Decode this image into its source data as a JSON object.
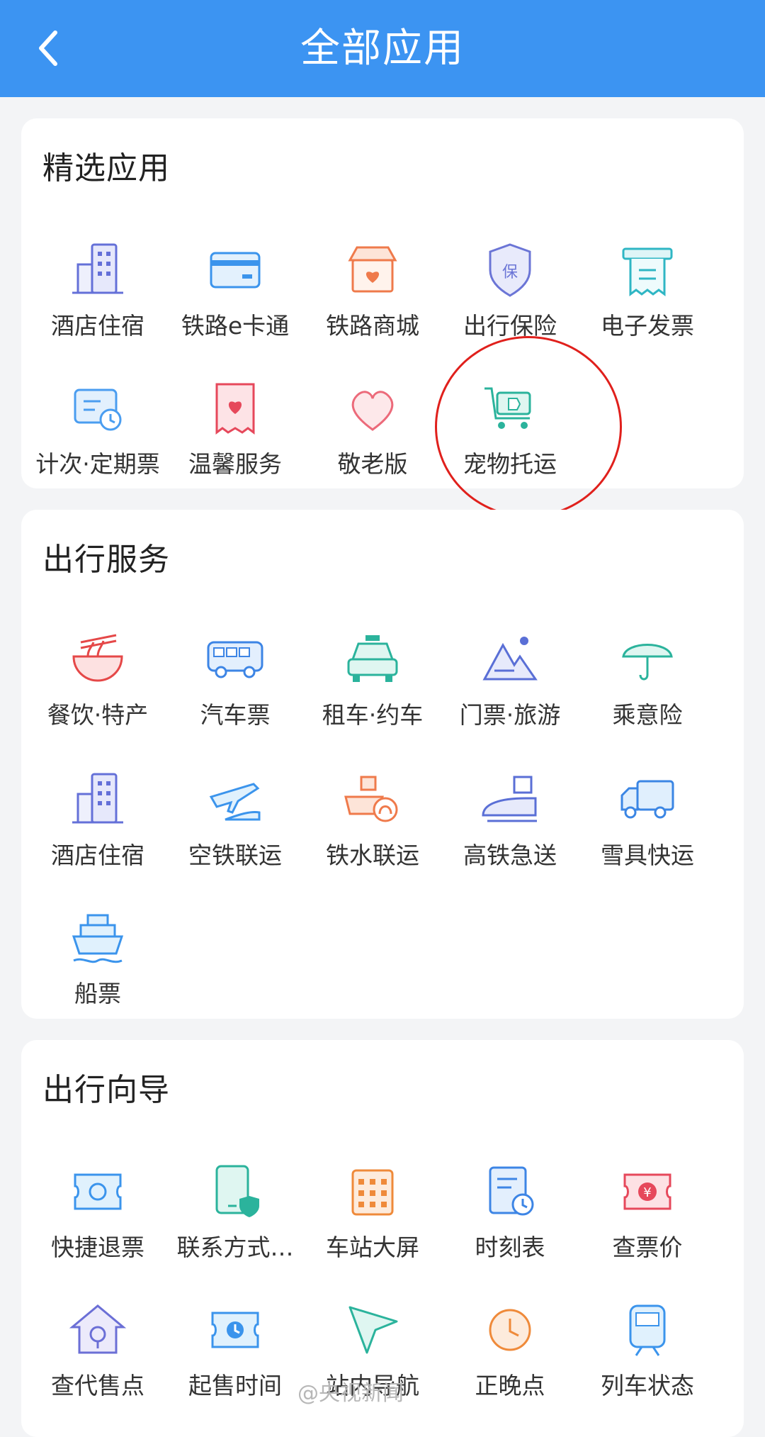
{
  "header": {
    "title": "全部应用",
    "back_icon": "chevron-left-icon"
  },
  "sections": [
    {
      "title": "精选应用",
      "items": [
        {
          "label": "酒店住宿",
          "icon": "hotel-icon"
        },
        {
          "label": "铁路e卡通",
          "icon": "card-icon"
        },
        {
          "label": "铁路商城",
          "icon": "shop-icon"
        },
        {
          "label": "出行保险",
          "icon": "insurance-shield-icon"
        },
        {
          "label": "电子发票",
          "icon": "invoice-icon"
        },
        {
          "label": "计次·定期票",
          "icon": "periodic-ticket-icon"
        },
        {
          "label": "温馨服务",
          "icon": "care-service-icon"
        },
        {
          "label": "敬老版",
          "icon": "heart-icon"
        },
        {
          "label": "宠物托运",
          "icon": "pet-cart-icon"
        }
      ]
    },
    {
      "title": "出行服务",
      "items": [
        {
          "label": "餐饮·特产",
          "icon": "noodle-bowl-icon"
        },
        {
          "label": "汽车票",
          "icon": "bus-icon"
        },
        {
          "label": "租车·约车",
          "icon": "taxi-icon"
        },
        {
          "label": "门票·旅游",
          "icon": "mountain-icon"
        },
        {
          "label": "乘意险",
          "icon": "umbrella-icon"
        },
        {
          "label": "酒店住宿",
          "icon": "hotel-icon"
        },
        {
          "label": "空铁联运",
          "icon": "plane-train-icon"
        },
        {
          "label": "铁水联运",
          "icon": "ship-rail-icon"
        },
        {
          "label": "高铁急送",
          "icon": "train-package-icon"
        },
        {
          "label": "雪具快运",
          "icon": "truck-icon"
        },
        {
          "label": "船票",
          "icon": "ship-icon"
        }
      ]
    },
    {
      "title": "出行向导",
      "items": [
        {
          "label": "快捷退票",
          "icon": "refund-ticket-icon"
        },
        {
          "label": "联系方式…",
          "icon": "phone-shield-icon"
        },
        {
          "label": "车站大屏",
          "icon": "station-screen-icon"
        },
        {
          "label": "时刻表",
          "icon": "timetable-icon"
        },
        {
          "label": "查票价",
          "icon": "ticket-price-icon"
        },
        {
          "label": "查代售点",
          "icon": "agency-icon"
        },
        {
          "label": "起售时间",
          "icon": "sale-time-icon"
        },
        {
          "label": "站内导航",
          "icon": "navigation-icon"
        },
        {
          "label": "正晚点",
          "icon": "clock-icon"
        },
        {
          "label": "列车状态",
          "icon": "train-status-icon"
        }
      ]
    }
  ],
  "watermark": "@央视新闻",
  "colors": {
    "header": "#3c94f2",
    "highlight_circle": "#e0201c"
  }
}
